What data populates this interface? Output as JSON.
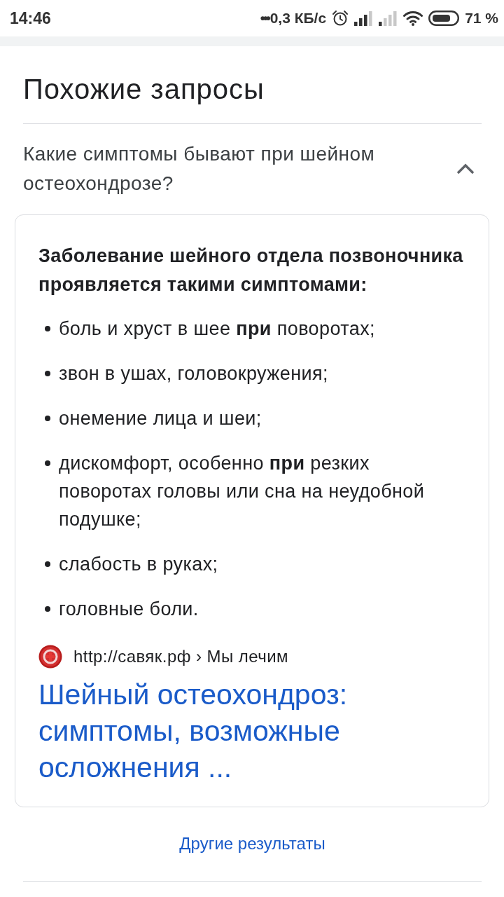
{
  "status_bar": {
    "time": "14:46",
    "notifications_more": "•••",
    "network_speed": "0,3 КБ/с",
    "battery_percent": "71 %"
  },
  "related_searches": {
    "title": "Похожие запросы",
    "questions": [
      {
        "text": "Какие симптомы бывают при шейном остеохондрозе?",
        "expanded": true,
        "answer": {
          "heading": "Заболевание шейного отдела позвоночника проявляется такими симптомами:",
          "items": [
            "боль и хруст в шее **при** поворотах;",
            "звон в ушах, головокружения;",
            "онемение лица и шеи;",
            "дискомфорт, особенно **при** резких поворотах головы или сна на неудобной подушке;",
            "слабость в руках;",
            "головные боли."
          ],
          "source": "http://савяк.рф › Мы лечим",
          "link_title": "Шейный остеохондроз: симптомы, возможные осложнения ..."
        }
      }
    ]
  },
  "more_results": "Другие результаты"
}
